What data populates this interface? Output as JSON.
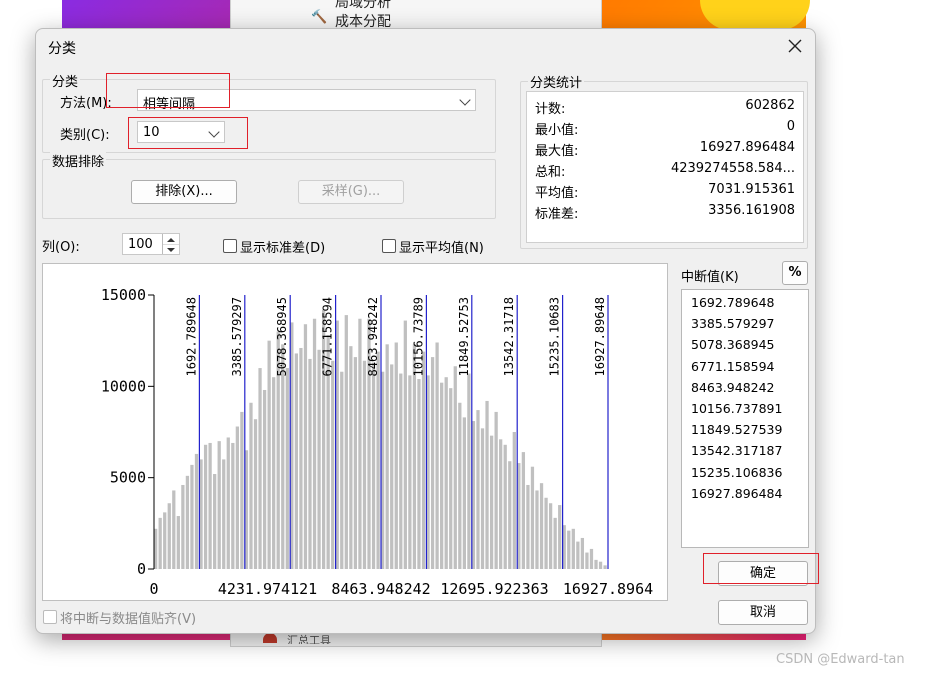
{
  "background": {
    "menu_item_1": "局域分析",
    "menu_item_2": "成本分配",
    "menu_item_3": "汇总工具"
  },
  "dialog": {
    "title": "分类",
    "close_icon": "close-icon"
  },
  "classification": {
    "group_label": "分类",
    "method_label": "方法(M):",
    "method_value": "相等间隔",
    "classes_label": "类别(C):",
    "classes_value": "10"
  },
  "exclusion": {
    "group_label": "数据排除",
    "exclude_button": "排除(X)...",
    "sample_button": "采样(G)..."
  },
  "statistics": {
    "group_label": "分类统计",
    "rows": [
      {
        "label": "计数:",
        "value": "602862"
      },
      {
        "label": "最小值:",
        "value": "0"
      },
      {
        "label": "最大值:",
        "value": "16927.896484"
      },
      {
        "label": "总和:",
        "value": "4239274558.584..."
      },
      {
        "label": "平均值:",
        "value": "7031.915361"
      },
      {
        "label": "标准差:",
        "value": "3356.161908"
      }
    ]
  },
  "histogram_options": {
    "columns_label": "列(O):",
    "columns_value": "100",
    "show_std_label": "显示标准差(D)",
    "show_mean_label": "显示平均值(N)"
  },
  "breaks": {
    "label": "中断值(K)",
    "percent_button": "%",
    "values": [
      "1692.789648",
      "3385.579297",
      "5078.368945",
      "6771.158594",
      "8463.948242",
      "10156.737891",
      "11849.527539",
      "13542.317187",
      "15235.106836",
      "16927.896484"
    ]
  },
  "buttons": {
    "ok": "确定",
    "cancel": "取消"
  },
  "snap_label": "将中断与数据值贴齐(V)",
  "watermark": "CSDN @Edward-tan",
  "colors": {
    "bars": "#c0c0c0",
    "break_lines": "#2222cc",
    "highlight": "#e0202a"
  },
  "chart_data": {
    "type": "bar",
    "xlim": [
      0,
      16927.8964
    ],
    "ylim": [
      0,
      15000
    ],
    "y_ticks": [
      "15000",
      "10000",
      "5000",
      "0"
    ],
    "x_ticks": [
      "0",
      "4231.974121",
      "8463.948242",
      "12695.922363",
      "16927.8964"
    ],
    "break_labels": [
      "1692.789648",
      "3385.579297",
      "5078.368945",
      "6771.158594",
      "8463.948242",
      "10156.73789",
      "11849.52753",
      "13542.31718",
      "15235.10683",
      "16927.89648"
    ],
    "break_values": [
      1692.789648,
      3385.579297,
      5078.368945,
      6771.158594,
      8463.948242,
      10156.737891,
      11849.527539,
      13542.317187,
      15235.106836,
      16927.896484
    ],
    "values": [
      2200,
      2800,
      3100,
      3600,
      4300,
      2900,
      4600,
      5100,
      5700,
      6300,
      6000,
      6800,
      6900,
      5200,
      7000,
      6000,
      7200,
      6900,
      7800,
      8600,
      6500,
      9100,
      8200,
      11000,
      9800,
      12500,
      10500,
      13000,
      12300,
      11000,
      13500,
      11800,
      12100,
      13400,
      11500,
      13700,
      12000,
      14200,
      12800,
      11400,
      13600,
      10800,
      13900,
      12200,
      11600,
      13700,
      11400,
      13700,
      11300,
      11900,
      10800,
      12300,
      11200,
      12400,
      10700,
      13600,
      10600,
      12300,
      10400,
      11900,
      10600,
      11600,
      12400,
      10200,
      10500,
      9900,
      11100,
      9100,
      8300,
      10700,
      8100,
      8700,
      7700,
      9200,
      7300,
      8600,
      7100,
      6800,
      5900,
      7500,
      5800,
      6400,
      4600,
      5600,
      4300,
      4700,
      3900,
      3600,
      2800,
      3500,
      2400,
      2100,
      2200,
      1500,
      1700,
      900,
      1100,
      500,
      400,
      200
    ]
  }
}
